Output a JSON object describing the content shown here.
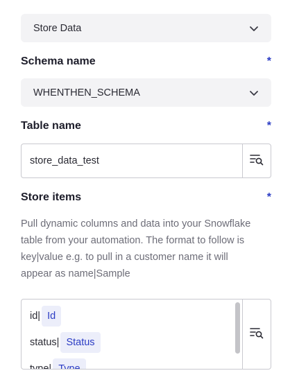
{
  "store_select": {
    "value": "Store Data",
    "icon": "chevron-down-icon"
  },
  "schema": {
    "label": "Schema name",
    "required_mark": "*",
    "value": "WHENTHEN_SCHEMA",
    "icon": "chevron-down-icon"
  },
  "table": {
    "label": "Table name",
    "required_mark": "*",
    "value": "store_data_test",
    "picker_icon": "variable-search-icon"
  },
  "store_items": {
    "label": "Store items",
    "required_mark": "*",
    "help_text": "Pull dynamic columns and data into your Snowflake table from your automation. The format to follow is key|value e.g. to pull in a customer name it will appear as name|Sample",
    "lines": [
      {
        "key": "id|",
        "pill": "Id"
      },
      {
        "key": "status|",
        "pill": "Status"
      },
      {
        "key": "type|",
        "pill": "Type"
      }
    ],
    "picker_icon": "variable-search-icon"
  },
  "colors": {
    "accent": "#2b3cc4",
    "pill_bg": "#eceefa",
    "select_bg": "#f3f3f5",
    "border": "#c9c9cf"
  }
}
